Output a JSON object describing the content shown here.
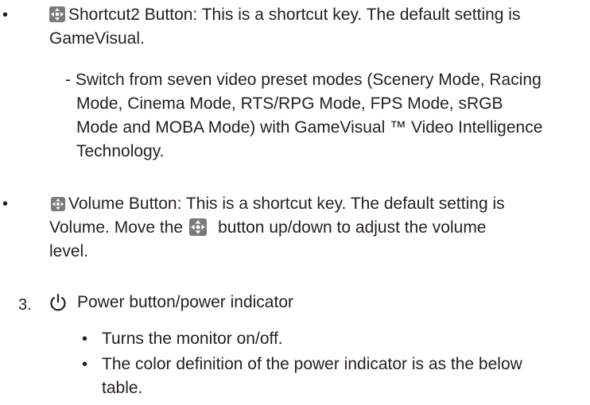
{
  "shortcut2": {
    "bullet": "•",
    "text_line1": "Shortcut2 Button: This is a shortcut key. The default setting is",
    "text_line2": "GameVisual.",
    "sub_line1": "- Switch from seven video preset modes (Scenery Mode, Racing",
    "sub_line2": "Mode, Cinema Mode, RTS/RPG Mode, FPS Mode, sRGB",
    "sub_line3": "Mode and MOBA Mode) with GameVisual ™ Video Intelligence",
    "sub_line4": "Technology."
  },
  "volume": {
    "bullet": "•",
    "text_line1": "Volume Button: This is a shortcut key. The default setting is",
    "text_line2a": "Volume. Move the",
    "text_line2b": "button up/down to adjust the volume",
    "text_line3": "level."
  },
  "power": {
    "number": "3.",
    "title": "Power button/power indicator",
    "items": [
      {
        "bullet": "•",
        "line1": "Turns the monitor on/off."
      },
      {
        "bullet": "•",
        "line1": "The color definition of the power indicator is as the below",
        "line2": "table."
      }
    ]
  },
  "icons": {
    "navigation_key": "five-way-navigation-key-icon",
    "power": "power-icon"
  },
  "colors": {
    "text": "#231f20",
    "icon_gray": "#7a7a7a"
  }
}
